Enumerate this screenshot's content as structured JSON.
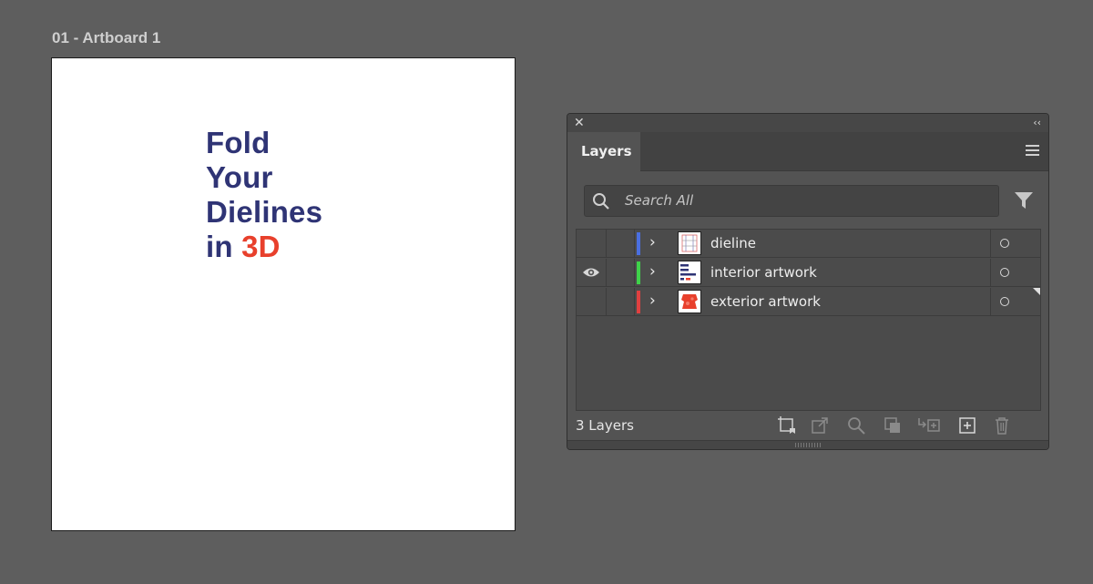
{
  "artboard": {
    "label": "01 - Artboard 1",
    "headline": {
      "line1": "Fold",
      "line2": "Your",
      "line3": "Dielines",
      "line4_prefix": "in",
      "line4_accent": "3D"
    }
  },
  "layers_panel": {
    "close_icon": "close-icon",
    "collapse_icon": "double-chevron-left-icon",
    "tab_label": "Layers",
    "menu_icon": "hamburger-menu-icon",
    "search_placeholder": "Search All",
    "filter_icon": "funnel-filter-icon",
    "layers": [
      {
        "name": "dieline",
        "color": "#4a6fe0",
        "visible": false,
        "thumbnail": "dieline"
      },
      {
        "name": "interior artwork",
        "color": "#3fd24a",
        "visible": true,
        "thumbnail": "interior text"
      },
      {
        "name": "exterior artwork",
        "color": "#e04040",
        "visible": false,
        "thumbnail": "exterior red"
      }
    ],
    "footer": {
      "count_label": "3 Layers",
      "icons": [
        "collect-for-export-icon",
        "export-icon",
        "locate-object-icon",
        "make-clipping-mask-icon",
        "create-sublayer-icon",
        "new-layer-icon",
        "delete-icon"
      ]
    }
  },
  "colors": {
    "canvas_bg": "#5e5e5e",
    "headline_blue": "#2f3475",
    "headline_red": "#e8402c"
  }
}
